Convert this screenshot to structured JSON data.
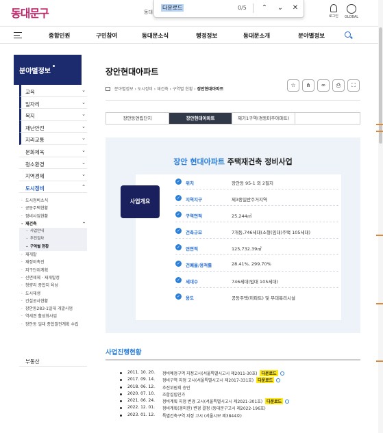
{
  "header": {
    "logo": "동대문구",
    "top_fragment": "동대",
    "login_label": "로그인",
    "global_label": "GLOBAL"
  },
  "findbar": {
    "query": "다운로드",
    "count": "0/5",
    "prev_glyph": "⌃",
    "next_glyph": "⌄",
    "close_glyph": "✕"
  },
  "gnb": [
    "종합민원",
    "구민참여",
    "동대문소식",
    "행정정보",
    "동대문소개",
    "분야별정보"
  ],
  "sidebar": {
    "title": "분야별정보",
    "items": [
      {
        "label": "교육"
      },
      {
        "label": "일자리"
      },
      {
        "label": "복지"
      },
      {
        "label": "재난안전"
      },
      {
        "label": "지리교통"
      },
      {
        "label": "문화체육"
      },
      {
        "label": "청소환경"
      },
      {
        "label": "지역경제"
      },
      {
        "label": "도시정비"
      }
    ],
    "sub_top": [
      "도시정비소식",
      "공동주택현황",
      "정비사업현황"
    ],
    "sub_active": "재건축",
    "subsub": [
      "사업안내",
      "추진절차",
      "구역별 현황"
    ],
    "sub_bottom": [
      "재개발",
      "재정비촉진",
      "지구단위계획",
      "신면제체 · 재개발정",
      "청량리 종합지 육성",
      "도시재생",
      "건설공사현황",
      "장안동283-1일대 개발사업",
      "역세권 활성화사업",
      "장안동 일대 종합발전계획 수립"
    ],
    "last": "부동산"
  },
  "page": {
    "title": "장안현대아파트",
    "breadcrumb": [
      "분야별정보",
      "도시정비",
      "재건축",
      "구역별 현황",
      "장안현대아파트"
    ]
  },
  "tabs": [
    "장안동연립단지",
    "장안현대아파트",
    "제기1구역(경동미주아파트)"
  ],
  "card": {
    "title_highlight": "장안 현대아파트",
    "title_rest": " 주택재건축 정비사업",
    "badge": "사업개요",
    "rows": [
      {
        "label": "위치",
        "value": "장안동 95-1 외 2필지"
      },
      {
        "label": "지역지구",
        "value": "제3종일반주거지역"
      },
      {
        "label": "구역면적",
        "value": "25,244㎡"
      },
      {
        "label": "건축규모",
        "value": "7개동,746세대(소형(임대)주택 105세대)"
      },
      {
        "label": "연면적",
        "value": "125,732.39㎡"
      },
      {
        "label": "건폐율/용적률",
        "value": "28.41%, 299.70%"
      },
      {
        "label": "세대수",
        "value": "746세대(임대 105세대)"
      },
      {
        "label": "용도",
        "value": "공동주택(아파트) 및 부대복리시설"
      }
    ]
  },
  "progress": {
    "title": "사업진행현황",
    "download_label": "다운로드",
    "items": [
      {
        "date": "2011. 10. 20.",
        "desc": "정비예정구역 지정고시(서울특별시고시 제2011-30호)",
        "download": true
      },
      {
        "date": "2017. 09. 14.",
        "desc": "정비구역 지정 고시(서울특별시고시 제2017-331호)",
        "download": true
      },
      {
        "date": "2018. 06. 12.",
        "desc": "추진위원회 승인",
        "download": false
      },
      {
        "date": "2020. 07. 10.",
        "desc": "조합설립인가",
        "download": false
      },
      {
        "date": "2021. 06. 24.",
        "desc": "정비계획 지정 변경 고시(서울특별시고시 제2021-301호)",
        "download": true
      },
      {
        "date": "2022. 12. 01.",
        "desc": "정비계획(경미한) 변경 결정 (동대문구고시 제2022-196호)",
        "download": false
      },
      {
        "date": "2023. 01. 12.",
        "desc": "특별건축구역 지정 고시 (서울시보 제3844호)",
        "download": false
      }
    ]
  },
  "colors": {
    "accent": "#2b7fd9",
    "navy": "#1c2a6e",
    "highlight": "#ffe814"
  }
}
